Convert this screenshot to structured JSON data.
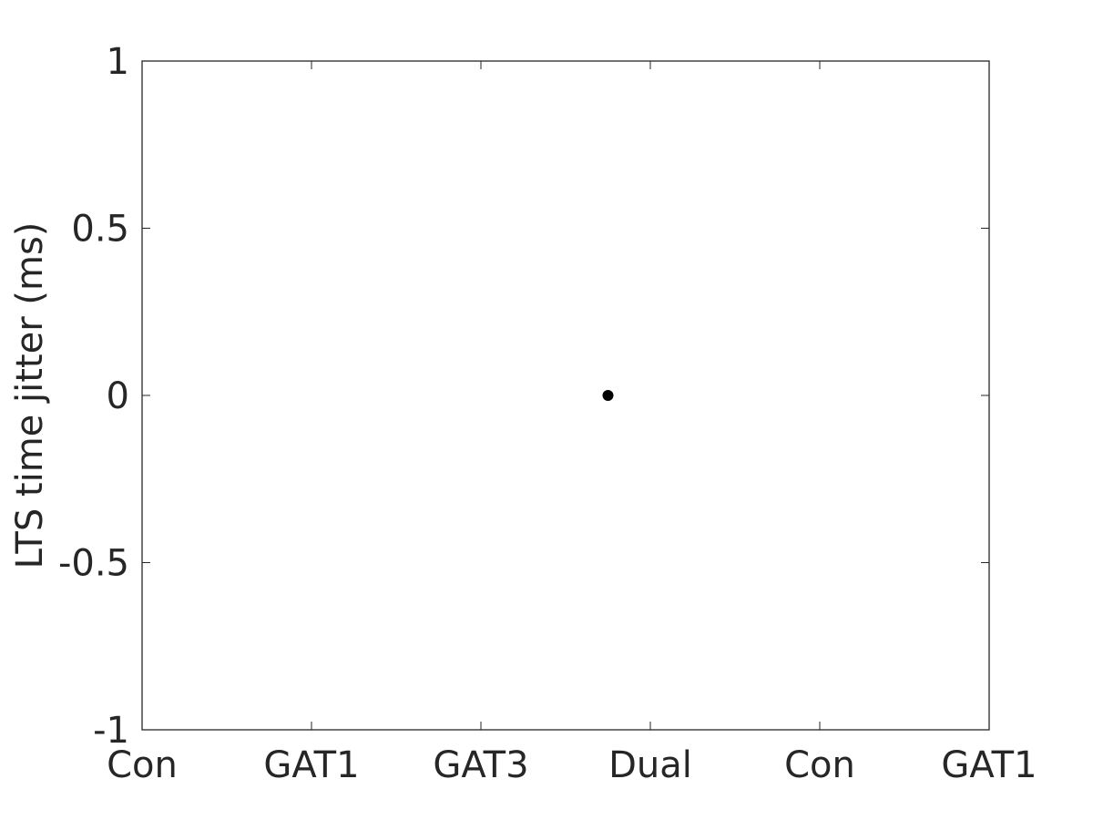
{
  "chart_data": {
    "type": "scatter",
    "title": "",
    "xlabel": "",
    "ylabel": "LTS time jitter (ms)",
    "categories": [
      "Con",
      "GAT1",
      "GAT3",
      "Dual",
      "Con",
      "GAT1"
    ],
    "xlim": [
      1,
      6
    ],
    "ylim": [
      -1,
      1
    ],
    "yticks": [
      -1,
      -0.5,
      0,
      0.5,
      1
    ],
    "ytick_labels": [
      "-1",
      "-0.5",
      "0",
      "0.5",
      "1"
    ],
    "grid": false,
    "legend": null,
    "series": [
      {
        "name": "data",
        "color": "#000000",
        "marker": "circle",
        "points": [
          {
            "x": 3.75,
            "y": 0
          }
        ]
      }
    ]
  },
  "colors": {
    "axis": "#262626",
    "text": "#262626",
    "background": "#ffffff"
  }
}
